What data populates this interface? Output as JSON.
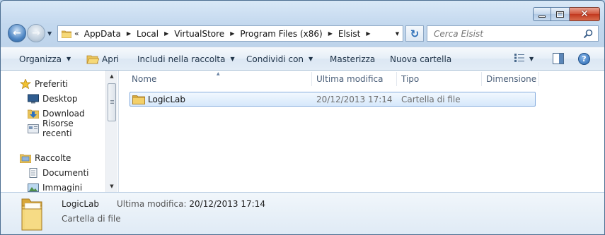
{
  "window": {
    "caption_buttons": {
      "minimize": "minimize",
      "maximize": "maximize",
      "close": "✕"
    }
  },
  "address": {
    "overflow_chevron": "«",
    "crumbs": [
      "AppData",
      "Local",
      "VirtualStore",
      "Program Files (x86)",
      "Elsist"
    ]
  },
  "search": {
    "placeholder": "Cerca Elsist"
  },
  "toolbar": {
    "organize": "Organizza",
    "open": "Apri",
    "include": "Includi nella raccolta",
    "share": "Condividi con",
    "burn": "Masterizza",
    "new_folder": "Nuova cartella",
    "help": "?"
  },
  "sidebar": {
    "favorites": "Preferiti",
    "items_fav": [
      "Desktop",
      "Download",
      "Risorse recenti"
    ],
    "libraries": "Raccolte",
    "items_lib": [
      "Documenti",
      "Immagini"
    ]
  },
  "columns": {
    "name": "Nome",
    "modified": "Ultima modifica",
    "type": "Tipo",
    "size": "Dimensione"
  },
  "files": [
    {
      "name": "LogicLab",
      "modified": "20/12/2013 17:14",
      "type": "Cartella di file",
      "selected": true
    }
  ],
  "details": {
    "name": "LogicLab",
    "type": "Cartella di file",
    "modified_label": "Ultima modifica:",
    "modified_value": "20/12/2013 17:14"
  },
  "colors": {
    "accent": "#2867b1",
    "selection": "#d6e8fb",
    "chrome": "#c3d8ee"
  }
}
